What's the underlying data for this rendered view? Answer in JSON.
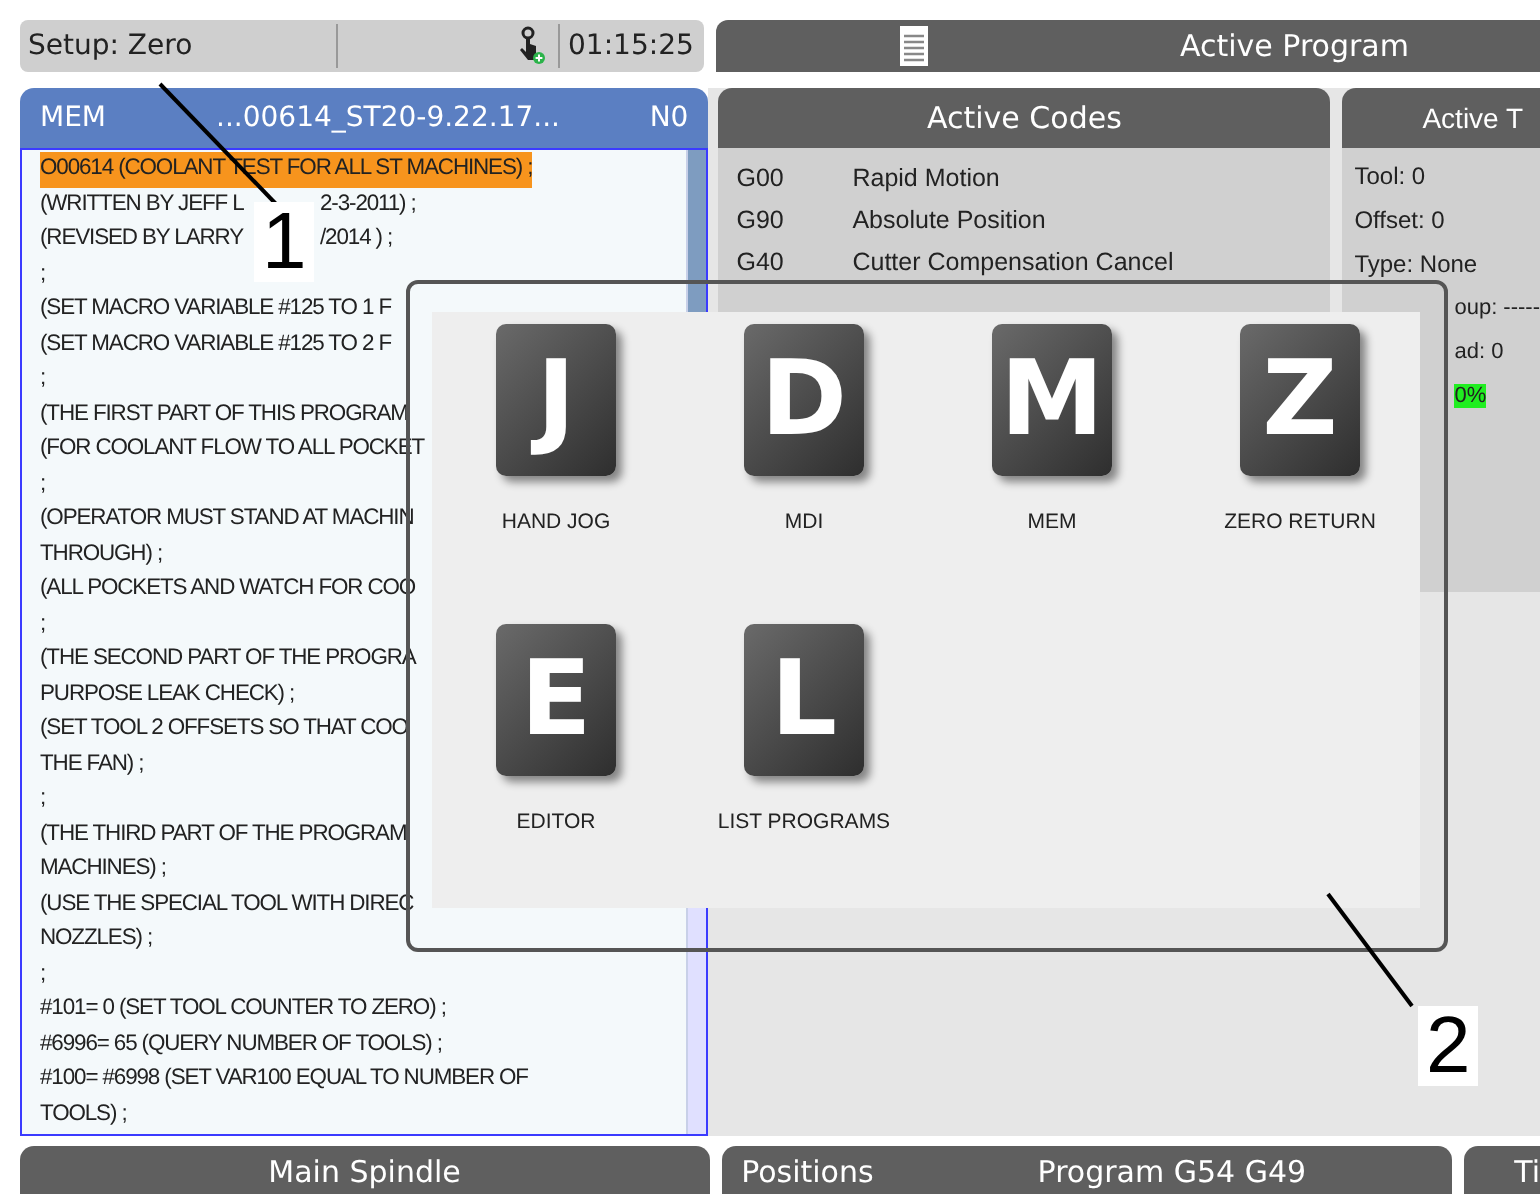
{
  "status_bar": {
    "mode": "Setup: Zero",
    "time": "01:15:25"
  },
  "active_program_bar": {
    "title": "Active Program"
  },
  "program_panel": {
    "mode": "MEM",
    "file": "...00614_ST20-9.22.17...",
    "line_number": "N0",
    "lines": [
      {
        "parts": [
          "O00614 (COOLANT TEST FOR ALL ST MACHINES) ;"
        ],
        "highlighted": true
      },
      {
        "parts": [
          "(WRITTEN BY JEFF L",
          "2-3-2011) ;"
        ],
        "highlighted": false
      },
      {
        "parts": [
          "(REVISED BY LARRY",
          "/2014 ) ;"
        ],
        "highlighted": false
      },
      {
        "parts": [
          ";"
        ],
        "highlighted": false
      },
      {
        "parts": [
          "(SET MACRO VARIABLE #125 TO 1 F"
        ],
        "highlighted": false
      },
      {
        "parts": [
          "(SET MACRO VARIABLE #125 TO 2 F"
        ],
        "highlighted": false
      },
      {
        "parts": [
          ";"
        ],
        "highlighted": false
      },
      {
        "parts": [
          "(THE FIRST PART OF THIS PROGRAM"
        ],
        "highlighted": false
      },
      {
        "parts": [
          "(FOR COOLANT FLOW TO ALL POCKET"
        ],
        "highlighted": false
      },
      {
        "parts": [
          ";"
        ],
        "highlighted": false
      },
      {
        "parts": [
          "(OPERATOR MUST STAND AT MACHIN"
        ],
        "highlighted": false
      },
      {
        "parts": [
          "THROUGH) ;"
        ],
        "highlighted": false
      },
      {
        "parts": [
          "(ALL POCKETS AND WATCH FOR COO"
        ],
        "highlighted": false
      },
      {
        "parts": [
          ";"
        ],
        "highlighted": false
      },
      {
        "parts": [
          "(THE SECOND PART OF THE PROGRA"
        ],
        "highlighted": false
      },
      {
        "parts": [
          "PURPOSE LEAK CHECK) ;"
        ],
        "highlighted": false
      },
      {
        "parts": [
          "(SET TOOL 2 OFFSETS SO THAT COO"
        ],
        "highlighted": false
      },
      {
        "parts": [
          "THE FAN) ;"
        ],
        "highlighted": false
      },
      {
        "parts": [
          ";"
        ],
        "highlighted": false
      },
      {
        "parts": [
          "(THE THIRD PART OF THE PROGRAM"
        ],
        "highlighted": false
      },
      {
        "parts": [
          "MACHINES) ;"
        ],
        "highlighted": false
      },
      {
        "parts": [
          "(USE THE SPECIAL TOOL WITH DIREC"
        ],
        "highlighted": false
      },
      {
        "parts": [
          "NOZZLES) ;"
        ],
        "highlighted": false
      },
      {
        "parts": [
          ";"
        ],
        "highlighted": false
      },
      {
        "parts": [
          "#101= 0 (SET TOOL COUNTER TO ZERO) ;"
        ],
        "highlighted": false
      },
      {
        "parts": [
          "#6996= 65 (QUERY NUMBER OF TOOLS) ;"
        ],
        "highlighted": false
      },
      {
        "parts": [
          "#100= #6998 (SET VAR100 EQUAL TO NUMBER OF"
        ],
        "highlighted": false
      },
      {
        "parts": [
          "TOOLS) ;"
        ],
        "highlighted": false
      }
    ]
  },
  "active_codes": {
    "title": "Active Codes",
    "rows": [
      {
        "code": "G00",
        "description": "Rapid Motion"
      },
      {
        "code": "G90",
        "description": "Absolute Position"
      },
      {
        "code": "G40",
        "description": "Cutter Compensation Cancel"
      }
    ]
  },
  "active_tool": {
    "title": "Active T",
    "lines": [
      {
        "text": "Tool: 0",
        "highlighted": false
      },
      {
        "text": "Offset: 0",
        "highlighted": false
      },
      {
        "text": "Type: None",
        "highlighted": false
      },
      {
        "text": "oup: -----",
        "highlighted": false
      },
      {
        "text": "ad: 0",
        "highlighted": false
      },
      {
        "text": "0%",
        "highlighted": true
      }
    ]
  },
  "mode_menu": {
    "items": [
      {
        "key": "J",
        "label": "HAND JOG"
      },
      {
        "key": "D",
        "label": "MDI"
      },
      {
        "key": "M",
        "label": "MEM"
      },
      {
        "key": "Z",
        "label": "ZERO RETURN"
      },
      {
        "key": "E",
        "label": "EDITOR"
      },
      {
        "key": "L",
        "label": "LIST PROGRAMS"
      }
    ]
  },
  "bottom_tabs": [
    {
      "labels": [
        "Main Spindle"
      ]
    },
    {
      "labels": [
        "Positions",
        "Program G54 G49"
      ]
    },
    {
      "labels": [
        "Ti"
      ]
    }
  ],
  "callouts": [
    "1",
    "2"
  ]
}
